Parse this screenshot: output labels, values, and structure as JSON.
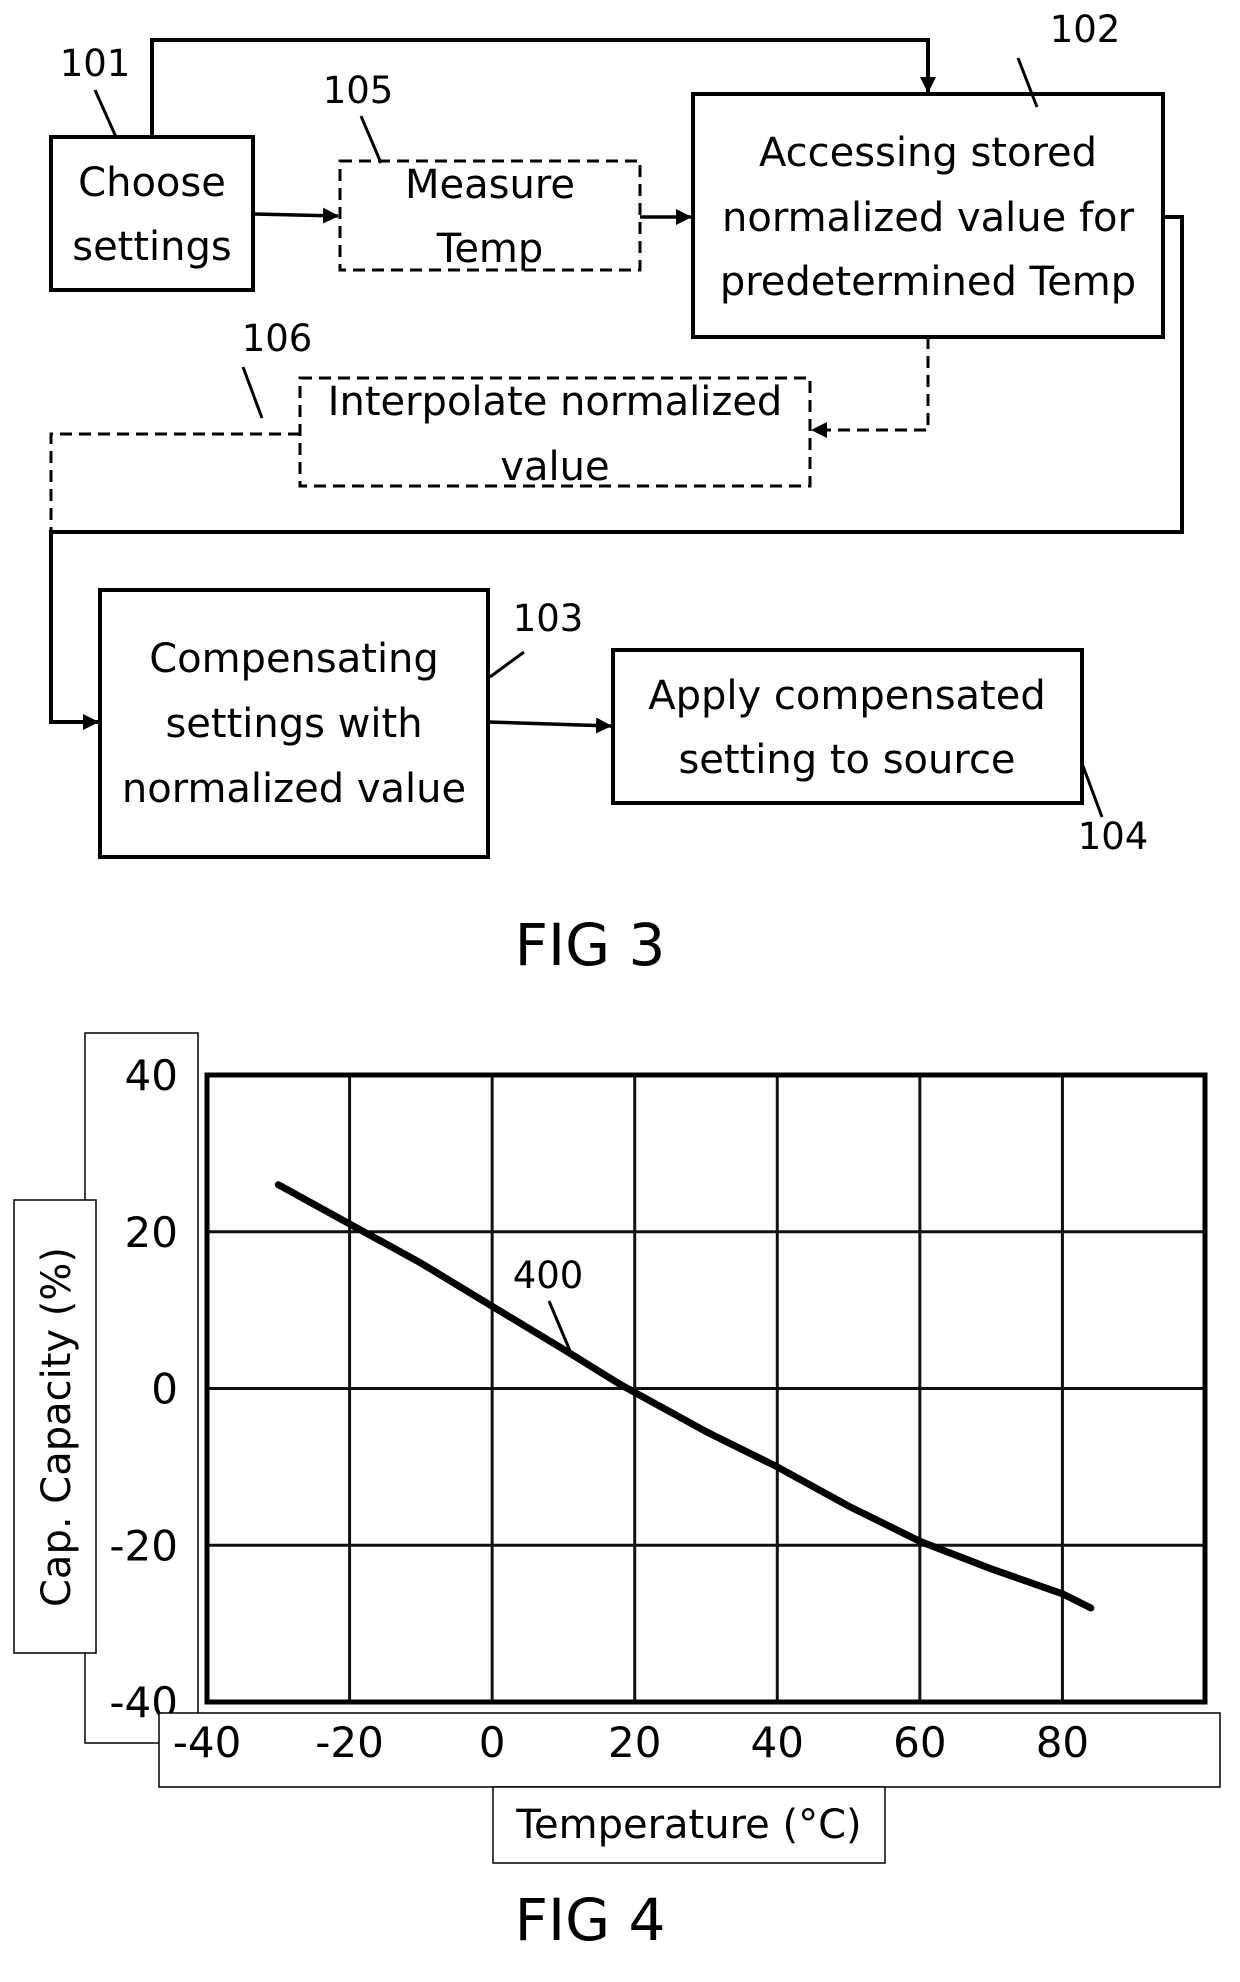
{
  "fig3": {
    "caption": "FIG 3",
    "steps": [
      {
        "ref": "101",
        "lines": [
          "Choose",
          "settings"
        ],
        "style": "solid"
      },
      {
        "ref": "105",
        "lines": [
          "Measure",
          "Temp"
        ],
        "style": "dashed"
      },
      {
        "ref": "102",
        "lines": [
          "Accessing stored",
          "normalized value for",
          "predetermined Temp"
        ],
        "style": "solid"
      },
      {
        "ref": "106",
        "lines": [
          "Interpolate normalized",
          "value"
        ],
        "style": "dashed"
      },
      {
        "ref": "103",
        "lines": [
          "Compensating",
          "settings with",
          "normalized value"
        ],
        "style": "solid"
      },
      {
        "ref": "104",
        "lines": [
          "Apply compensated",
          "setting to source"
        ],
        "style": "solid"
      }
    ],
    "connections": [
      {
        "from": "101",
        "to": "105",
        "style": "solid"
      },
      {
        "from": "105",
        "to": "102",
        "style": "solid"
      },
      {
        "from": "101",
        "to": "102",
        "style": "solid"
      },
      {
        "from": "102",
        "to": "106",
        "style": "dashed"
      },
      {
        "from": "102",
        "to": "103",
        "style": "solid"
      },
      {
        "from": "106",
        "to": "103",
        "style": "dashed"
      },
      {
        "from": "103",
        "to": "104",
        "style": "solid"
      }
    ]
  },
  "fig4": {
    "caption": "FIG 4",
    "curve_label": "400"
  },
  "chart_data": {
    "type": "line",
    "title": "",
    "xlabel": "Temperature (°C)",
    "ylabel": "Cap. Capacity (%)",
    "xlim": [
      -40,
      100
    ],
    "ylim": [
      -40,
      40
    ],
    "x_ticks": [
      "-40",
      "-20",
      "0",
      "20",
      "40",
      "60",
      "80"
    ],
    "y_ticks": [
      "40",
      "20",
      "0",
      "-20",
      "-40"
    ],
    "grid": true,
    "series": [
      {
        "name": "400",
        "x": [
          -30,
          -20,
          -10,
          0,
          10,
          18,
          20,
          30,
          40,
          50,
          60,
          70,
          80,
          84
        ],
        "y": [
          26,
          21,
          16,
          10.5,
          5,
          0.5,
          -0.5,
          -5.5,
          -10,
          -15,
          -19.5,
          -23,
          -26.2,
          -28
        ]
      }
    ]
  }
}
